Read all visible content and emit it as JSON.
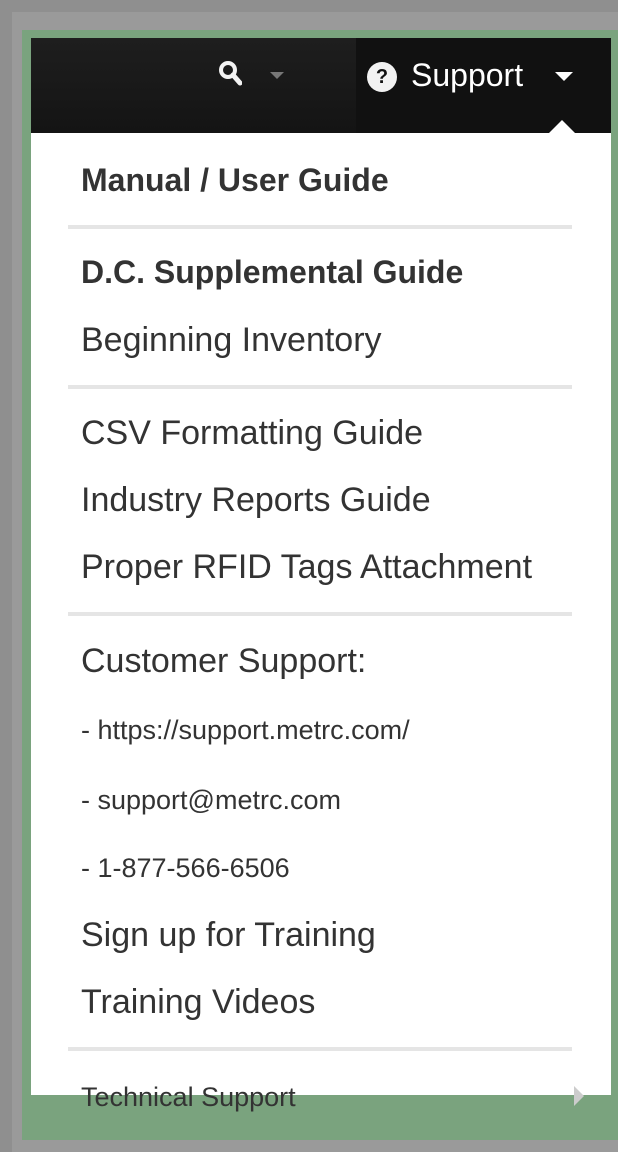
{
  "navbar": {
    "search_icon": "search-icon",
    "support_label": "Support",
    "help_icon_glyph": "?"
  },
  "menu": {
    "manual": "Manual / User Guide",
    "dc_guide": "D.C. Supplemental Guide",
    "beginning_inventory": "Beginning Inventory",
    "csv_guide": "CSV Formatting Guide",
    "industry_reports": "Industry Reports Guide",
    "rfid_tags": "Proper RFID Tags Attachment",
    "customer_support": "Customer Support:",
    "support_url": "- https://support.metrc.com/",
    "support_email": "- support@metrc.com",
    "support_phone": "- 1-877-566-6506",
    "sign_up_training": "Sign up for Training",
    "training_videos": "Training Videos",
    "technical_support": "Technical Support"
  }
}
